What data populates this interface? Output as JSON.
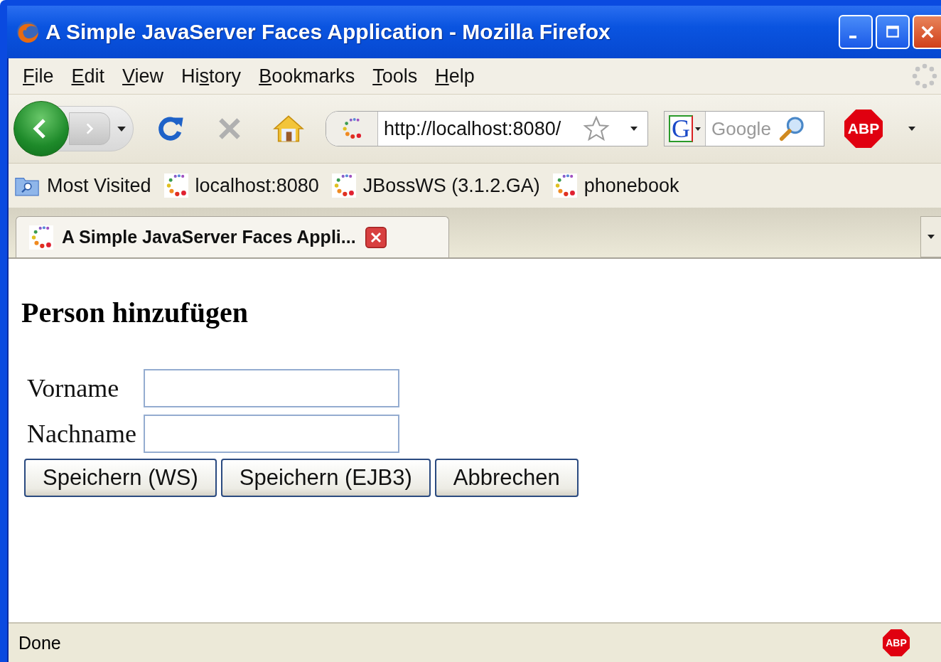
{
  "window": {
    "title": "A Simple JavaServer Faces Application - Mozilla Firefox"
  },
  "menu": [
    {
      "key": "F",
      "after": "ile"
    },
    {
      "key": "E",
      "after": "dit"
    },
    {
      "key": "V",
      "after": "iew"
    },
    {
      "before": "Hi",
      "key": "s",
      "after": "tory"
    },
    {
      "key": "B",
      "after": "ookmarks"
    },
    {
      "key": "T",
      "after": "ools"
    },
    {
      "key": "H",
      "after": "elp"
    }
  ],
  "toolbar": {
    "address": "http://localhost:8080/",
    "engine_label": "G",
    "search_placeholder": "Google",
    "abp_label": "ABP"
  },
  "bookmarks": [
    {
      "kind": "folder",
      "label": "Most Visited"
    },
    {
      "kind": "page",
      "label": "localhost:8080"
    },
    {
      "kind": "page",
      "label": "JBossWS (3.1.2.GA)"
    },
    {
      "kind": "page",
      "label": "phonebook"
    }
  ],
  "tabs": [
    {
      "label": "A Simple JavaServer Faces Appli...",
      "selected": true
    }
  ],
  "page": {
    "heading": "Person hinzufügen",
    "fields": [
      {
        "label": "Vorname"
      },
      {
        "label": "Nachname"
      }
    ],
    "buttons": [
      "Speichern (WS)",
      "Speichern (EJB3)",
      "Abbrechen"
    ]
  },
  "status_bar": {
    "text": "Done",
    "abp_label": "ABP"
  }
}
